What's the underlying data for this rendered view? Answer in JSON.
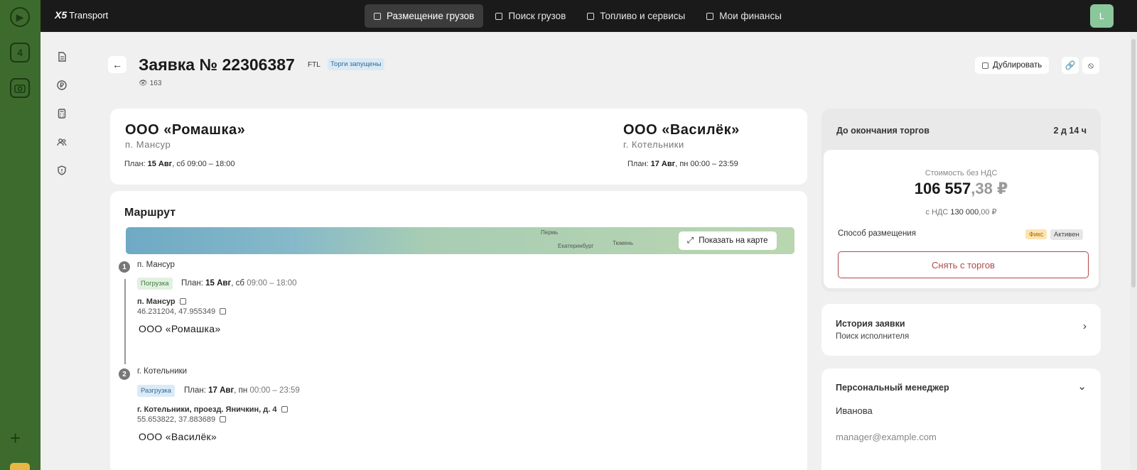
{
  "dock": {
    "four_label": "4",
    "plus_label": "+"
  },
  "topbar": {
    "logo_mark": "X5",
    "logo_text": "Transport",
    "nav": [
      {
        "label": "Размещение грузов",
        "active": true
      },
      {
        "label": "Поиск грузов",
        "active": false
      },
      {
        "label": "Топливо и сервисы",
        "active": false
      },
      {
        "label": "Мои финансы",
        "active": false
      }
    ],
    "avatar": "L"
  },
  "sidebar": {
    "icons": [
      "document-icon",
      "ruble-icon",
      "calculator-icon",
      "users-icon",
      "shield-icon"
    ]
  },
  "header": {
    "back": "←",
    "title": "Заявка № 22306387",
    "type": "FTL",
    "status": "Торги запущены",
    "views": "163",
    "duplicate": "Дублировать",
    "link_icon": "🔗",
    "block_icon": "⦸"
  },
  "parties": {
    "from": {
      "name": "ООО «Ромашка»",
      "city": "п. Мансур",
      "plan_prefix": "План:",
      "plan_date": "15 Авг",
      "plan_rest": ", сб 09:00 – 18:00"
    },
    "to": {
      "name": "ООО «Василёк»",
      "city": "г. Котельники",
      "plan_prefix": "План:",
      "plan_date": "17 Авг",
      "plan_rest": ", пн 00:00 – 23:59"
    }
  },
  "route": {
    "title": "Маршрут",
    "map_cities": [
      "Пермь",
      "Екатеринбург",
      "Тюмень"
    ],
    "show_on_map": "Показать на карте",
    "stops": [
      {
        "num": "1",
        "city": "п. Мансур",
        "chip": "Погрузка",
        "plan_prefix": "План:",
        "plan_date": "15 Авг",
        "plan_day": ", сб",
        "plan_time": "09:00 – 18:00",
        "address": "п. Мансур",
        "coords": "46.231204, 47.955349",
        "company": "ООО «Ромашка»"
      },
      {
        "num": "2",
        "city": "г. Котельники",
        "chip": "Разгрузка",
        "plan_prefix": "План:",
        "plan_date": "17 Авг",
        "plan_day": ", пн",
        "plan_time": "00:00 – 23:59",
        "address": "г. Котельники, проезд. Яничкин, д. 4",
        "coords": "55.653822, 37.883689",
        "company": "ООО «Василёк»"
      }
    ]
  },
  "auction": {
    "label": "До окончания торгов",
    "time_left": "2 д 14 ч",
    "cost_label": "Стоимость без НДС",
    "cost_int": "106 557",
    "cost_frac": ",38 ₽",
    "vat_prefix": "с НДС",
    "vat_int": "130 000",
    "vat_frac": ",00 ₽",
    "method_label": "Способ размещения",
    "method_pill": "Фикс",
    "status_pill": "Активен",
    "withdraw": "Снять с торгов"
  },
  "history": {
    "title": "История заявки",
    "subtitle": "Поиск исполнителя",
    "chevron": "›"
  },
  "manager": {
    "title": "Персональный менеджер",
    "chevron": "⌄",
    "name": "Иванова",
    "email": "manager@example.com"
  },
  "colors": {
    "topbar": "#1a1a1a",
    "dock": "#3d6b2e",
    "danger": "#b24848",
    "load_chip": "#e2f0e2",
    "unload_chip": "#dceaf6"
  }
}
